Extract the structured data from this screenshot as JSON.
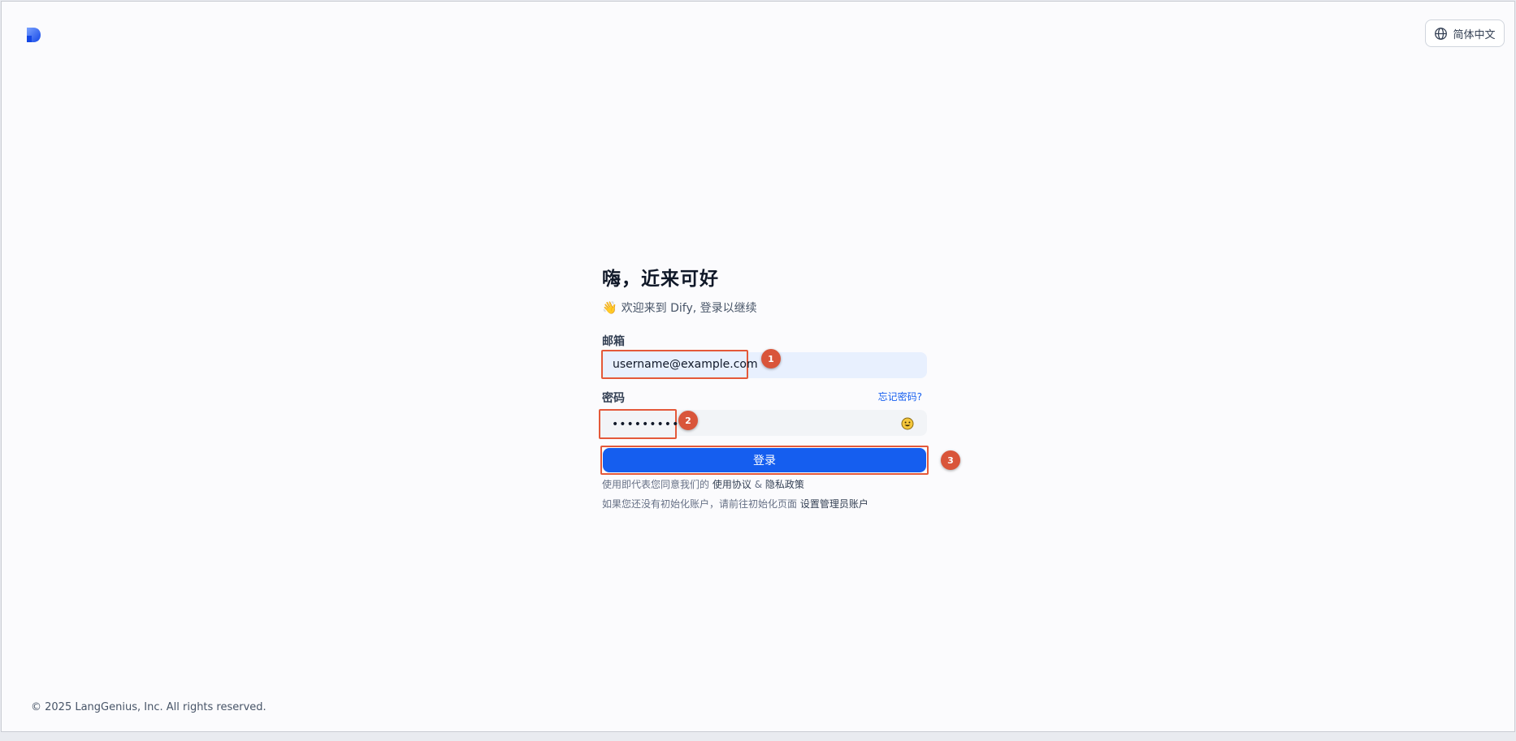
{
  "header": {
    "language_label": "简体中文",
    "language_icon": "globe-icon",
    "logo_icon": "dify-logo-icon"
  },
  "login": {
    "title": "嗨，近来可好",
    "subtitle_emoji": "👋",
    "subtitle": "欢迎来到 Dify, 登录以继续",
    "email_label": "邮箱",
    "email_value": "username@example.com",
    "password_label": "密码",
    "password_value": "•••••••••••",
    "forgot_link": "忘记密码?",
    "submit_label": "登录",
    "terms_prefix": "使用即代表您同意我们的",
    "terms_link": "使用协议",
    "terms_and": "&",
    "privacy_link": "隐私政策",
    "setup_prefix": "如果您还没有初始化账户，请前往初始化页面",
    "setup_link": "设置管理员账户"
  },
  "annotations": {
    "badge_1": "1",
    "badge_2": "2",
    "badge_3": "3",
    "highlight_color": "#e4593a"
  },
  "footer": {
    "copyright": "© 2025 LangGenius, Inc. All rights reserved."
  },
  "colors": {
    "primary": "#155eef",
    "background": "#fbfbfd",
    "input_bg": "#f2f4f7",
    "autofill_bg": "#e8f0fe"
  }
}
